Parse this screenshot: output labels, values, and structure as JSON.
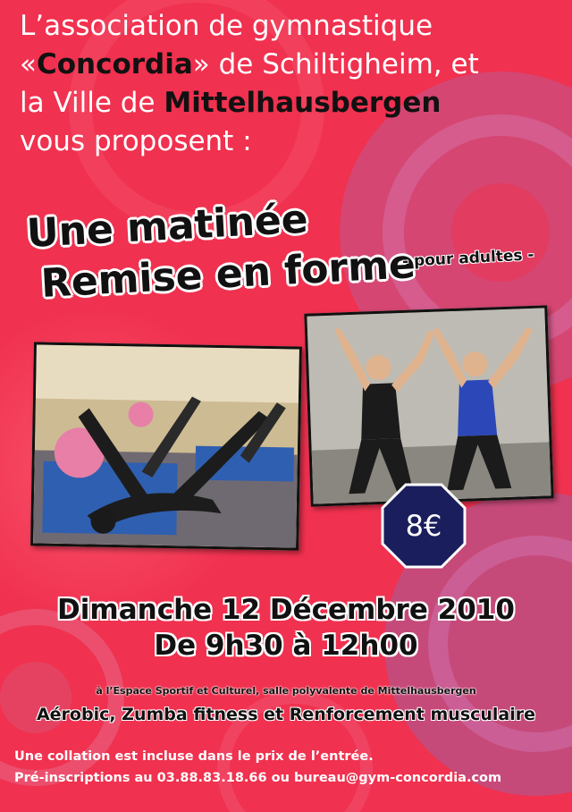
{
  "intro": {
    "line1": "L’association de gymnastique",
    "line2_open": "«",
    "line2_name": "Concordia",
    "line2_rest": "» de Schiltigheim, et",
    "line3_a": "la",
    "line3_b": "Ville de",
    "line3_name": "Mittelhausbergen",
    "line4": "vous proposent :"
  },
  "headline": {
    "line1": "Une matinée",
    "line2": "Remise en forme",
    "tag": "- pour adultes -"
  },
  "price": "8€",
  "event": {
    "date": "Dimanche 12 Décembre 2010",
    "hours": "De 9h30 à 12h00",
    "place": "à l’Espace Sportif et Culturel, salle polyvalente de Mittelhausbergen",
    "activities": "Aérobic, Zumba fitness et Renforcement musculaire"
  },
  "notes": {
    "line1": "Une collation est incluse dans le prix de l’entrée.",
    "line2": "Pré-inscriptions au 03.88.83.18.66 ou bureau@gym-concordia.com"
  },
  "colors": {
    "background": "#f0314f",
    "circle": "#b85a8e",
    "price_badge": "#1a1e5c"
  }
}
